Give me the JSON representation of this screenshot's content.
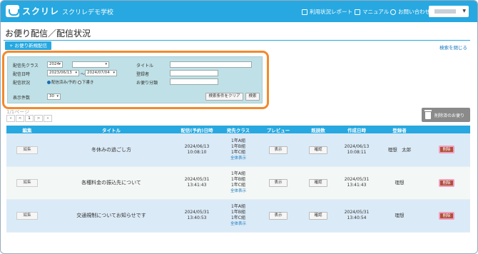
{
  "header": {
    "logo_text": "スクリレ",
    "school_name": "スクリレデモ学校",
    "links": [
      "利用状況レポート",
      "マニュアル",
      "お問い合わせ"
    ]
  },
  "page": {
    "title": "お便り配信／配信状況",
    "new_button": "+ お便り新規配信",
    "close_search": "検索を閉じる"
  },
  "search": {
    "class_label": "配信先クラス",
    "year_value": "2024",
    "class_value": "",
    "date_label": "配信日時",
    "date_from": "2023/06/13",
    "date_sep": "〜",
    "date_to": "2024/07/04",
    "status_label": "配信状況",
    "status_options": [
      "配信済み/予約",
      "下書き"
    ],
    "title_label": "タイトル",
    "title_value": "",
    "author_label": "登録者",
    "author_value": "",
    "category_label": "お便り分類",
    "category_value": "",
    "per_page_label": "表示件数",
    "per_page_value": "30",
    "clear_button": "検索条件をクリア",
    "search_button": "検索"
  },
  "pager": {
    "title": "1/1ページ",
    "buttons": [
      "«",
      "<",
      "1",
      ">",
      "»"
    ]
  },
  "trash_button": "削除済のお便り",
  "table": {
    "headers": [
      "編集",
      "タイトル",
      "配信(予約)日時",
      "宛先クラス",
      "プレビュー",
      "既読数",
      "作成日時",
      "登録者",
      ""
    ],
    "rows": [
      {
        "edit": "編集",
        "title": "冬休みの過ごし方",
        "date": "2024/06/13",
        "time": "10:08:10",
        "classes": [
          "1年A組",
          "1年B組",
          "1年C組"
        ],
        "more": "全体表示",
        "preview": "表示",
        "read": "確認",
        "created_date": "2024/06/13",
        "created_time": "10:08:11",
        "author": "理想　太郎",
        "delete": "削除"
      },
      {
        "edit": "編集",
        "title": "各種料金の振込先について",
        "date": "2024/05/31",
        "time": "13:41:43",
        "classes": [
          "1年A組",
          "1年B組",
          "1年C組"
        ],
        "more": "全体表示",
        "preview": "表示",
        "read": "確認",
        "created_date": "2024/05/31",
        "created_time": "13:41:43",
        "author": "理想",
        "delete": "削除"
      },
      {
        "edit": "編集",
        "title": "交通規制についてお知らせです",
        "date": "2024/05/31",
        "time": "13:40:53",
        "classes": [
          "1年A組",
          "1年B組",
          "1年C組"
        ],
        "more": "全体表示",
        "preview": "表示",
        "read": "確認",
        "created_date": "2024/05/31",
        "created_time": "13:40:54",
        "author": "理想",
        "delete": "削除"
      }
    ]
  }
}
